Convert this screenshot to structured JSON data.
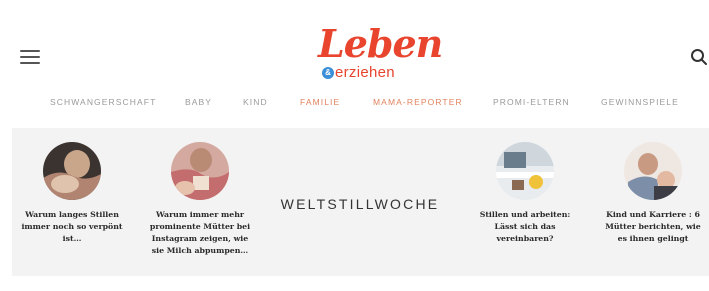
{
  "header": {
    "logo": {
      "main": "Leben",
      "amp": "&",
      "sub": "erziehen"
    }
  },
  "nav": {
    "items": [
      {
        "label": "SCHWANGERSCHAFT",
        "accent": false
      },
      {
        "label": "BABY",
        "accent": false
      },
      {
        "label": "KIND",
        "accent": false
      },
      {
        "label": "FAMILIE",
        "accent": true
      },
      {
        "label": "MAMA-REPORTER",
        "accent": true
      },
      {
        "label": "PROMI-ELTERN",
        "accent": false
      },
      {
        "label": "GEWINNSPIELE",
        "accent": false
      }
    ]
  },
  "feature": {
    "title": "WELTSTILLWOCHE",
    "articles": [
      {
        "title_lines": [
          "Warum langes Stillen",
          "immer noch so verpönt",
          "ist…"
        ]
      },
      {
        "title_lines": [
          "Warum immer mehr",
          "prominente Mütter bei",
          "Instagram zeigen, wie",
          "sie Milch abpumpen…"
        ]
      },
      {
        "title_lines": [
          "Stillen und arbeiten:",
          "Lässt sich das",
          "vereinbaren?"
        ]
      },
      {
        "title_lines": [
          "Kind und Karriere : 6",
          "Mütter berichten, wie",
          "es ihnen gelingt"
        ]
      }
    ]
  },
  "colors": {
    "brand": "#e8442e",
    "accent_blue": "#3b8ed8",
    "nav_text": "#9a9a9a",
    "nav_accent": "#e0825e",
    "band": "#f3f3f3"
  },
  "icons": [
    "hamburger-menu-icon",
    "search-icon"
  ]
}
